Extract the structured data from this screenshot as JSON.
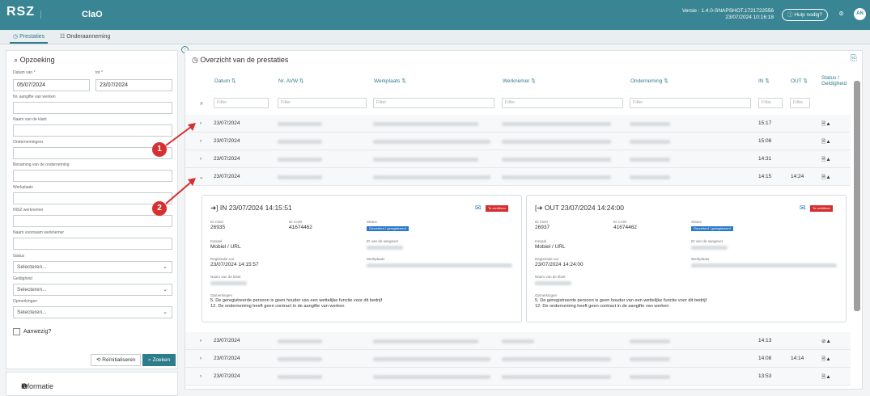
{
  "app": {
    "logo": "RSZ",
    "name": "ClaO",
    "version_line1": "Versie : 1.4.0-SNAPSHOT.1721722556",
    "version_line2": "23/07/2024 10:16:18",
    "help": "Hulp nodig?",
    "avatar": "AN"
  },
  "tabs": [
    {
      "label": "Prestaties",
      "icon": "clock-icon"
    },
    {
      "label": "Onderaanneming",
      "icon": "list-icon"
    }
  ],
  "search": {
    "title": "Opzoeking",
    "date_from_label": "Datum van *",
    "date_from": "05/07/2024",
    "date_to_label": "tot *",
    "date_to": "23/07/2024",
    "fields": [
      "Nr. aangifte van werken",
      "Naam van de klant",
      "Ondernemingsnr.",
      "Benaming van de onderneming",
      "Werkplaats",
      "INSZ werknemer",
      "Naam voornaam werknemer"
    ],
    "selects": [
      {
        "label": "Status",
        "value": "Selecteren..."
      },
      {
        "label": "Geldigheid",
        "value": "Selecteren..."
      },
      {
        "label": "Opmerkingen",
        "value": "Selecteren..."
      }
    ],
    "checkbox": "Aanwezig?",
    "reset": "Reïnitialiseren",
    "submit": "Zoeken"
  },
  "info_title": "Informatie",
  "overview": {
    "title": "Overzicht van de prestaties",
    "headers": [
      "Datum",
      "Nr. AVW",
      "Werkplaats",
      "Werknemer",
      "Onderneming",
      "IN",
      "OUT",
      "Status / Geldigheid"
    ],
    "filter_placeholder": "Filter",
    "rows_top": [
      {
        "date": "23/07/2024",
        "in": "15:17",
        "out": ""
      },
      {
        "date": "23/07/2024",
        "in": "15:08",
        "out": ""
      },
      {
        "date": "23/07/2024",
        "in": "14:31",
        "out": ""
      },
      {
        "date": "23/07/2024",
        "in": "14:15",
        "out": "14:24"
      }
    ],
    "rows_bottom": [
      {
        "date": "23/07/2024",
        "in": "14:13",
        "out": ""
      },
      {
        "date": "23/07/2024",
        "in": "14:08",
        "out": "14:14"
      },
      {
        "date": "23/07/2024",
        "in": "13:53",
        "out": ""
      }
    ]
  },
  "detail_in": {
    "title": "IN 23/07/2024 14:15:51",
    "id_clao_label": "ID ClaO",
    "id_clao": "26935",
    "id_caw_label": "ID CAW",
    "id_caw": "41674462",
    "status_label": "Status",
    "status": "Gecreëerd / geregistreerd",
    "kanaal_label": "Kanaal",
    "kanaal": "Mobiel / URL",
    "id_sender_label": "ID van de aangever",
    "reg_label": "Registratie-uur",
    "reg": "23/07/2024 14:15:57",
    "werkplaats_label": "Werkplaats",
    "klant_label": "Naam van de klant",
    "opm_label": "Opmerkingen",
    "opm1": "5. De geregistreerde persoon is geen houder van een wettelijke functie voor dit bedrijf",
    "opm2": "12. De onderneming heeft geen contract in de aangifte van werken",
    "badge": "Te verifiëren"
  },
  "detail_out": {
    "title": "OUT 23/07/2024 14:24:00",
    "id_clao_label": "ID ClaO",
    "id_clao": "26937",
    "id_caw_label": "ID CAW",
    "id_caw": "41674462",
    "status_label": "Status",
    "status": "Gecreëerd / geregistreerd",
    "kanaal_label": "Kanaal",
    "kanaal": "Mobiel / URL",
    "id_sender_label": "ID van de aangever",
    "reg_label": "Registratie-uur",
    "reg": "23/07/2024 14:24:00",
    "werkplaats_label": "Werkplaats",
    "klant_label": "Naam van de klant",
    "opm_label": "Opmerkingen",
    "opm1": "5. De geregistreerde persoon is geen houder van een wettelijke functie voor dit bedrijf",
    "opm2": "12. De onderneming heeft geen contract in de aangifte van werken",
    "badge": "Te verifiëren"
  },
  "annotations": [
    "1",
    "2"
  ]
}
